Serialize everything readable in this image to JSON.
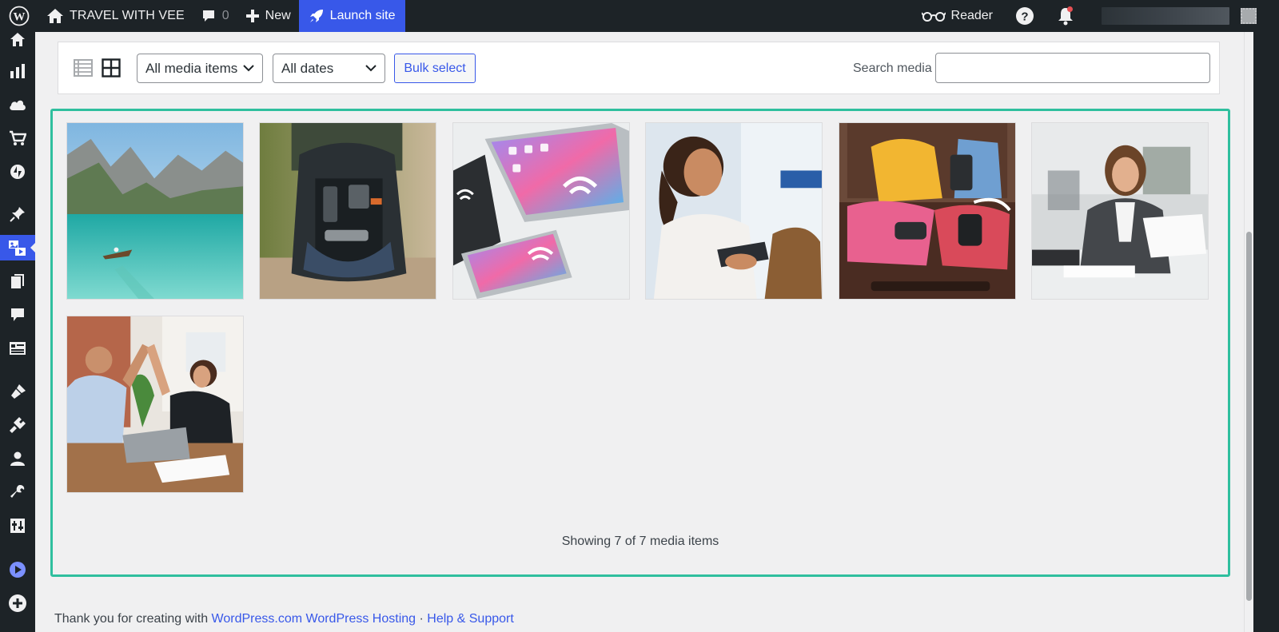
{
  "adminbar": {
    "site_name": "TRAVEL WITH VEE",
    "comments_count": "0",
    "new_label": "New",
    "launch_label": "Launch site",
    "reader_label": "Reader"
  },
  "sidebar": {
    "items": [
      "home-icon",
      "stats-icon",
      "cloud-icon",
      "cart-icon",
      "jetpack-icon",
      "pin-icon",
      "media-icon",
      "pages-icon",
      "comments-icon",
      "feedback-icon",
      "appearance-icon",
      "plugins-icon",
      "users-icon",
      "tools-icon",
      "settings-icon",
      "play-icon",
      "add-icon"
    ],
    "active": "media-icon"
  },
  "toolbar": {
    "type_filter": "All media items",
    "date_filter": "All dates",
    "bulk_select_label": "Bulk select",
    "search_label": "Search media",
    "search_value": ""
  },
  "media": {
    "items": [
      "mountain-lake-boat",
      "open-backpack",
      "tablet-and-phone-wifi",
      "woman-with-phone-airport",
      "open-suitcase-clothes",
      "woman-reading-documents",
      "office-high-five"
    ],
    "status": "Showing 7 of 7 media items"
  },
  "footer": {
    "text": "Thank you for creating with",
    "link1": "WordPress.com",
    "link2": "WordPress Hosting",
    "separator": "·",
    "link3": "Help & Support"
  },
  "colors": {
    "admin_bar": "#1d2327",
    "accent": "#3858e9",
    "selection_frame": "#2fbf9e",
    "notification": "#e65054"
  }
}
